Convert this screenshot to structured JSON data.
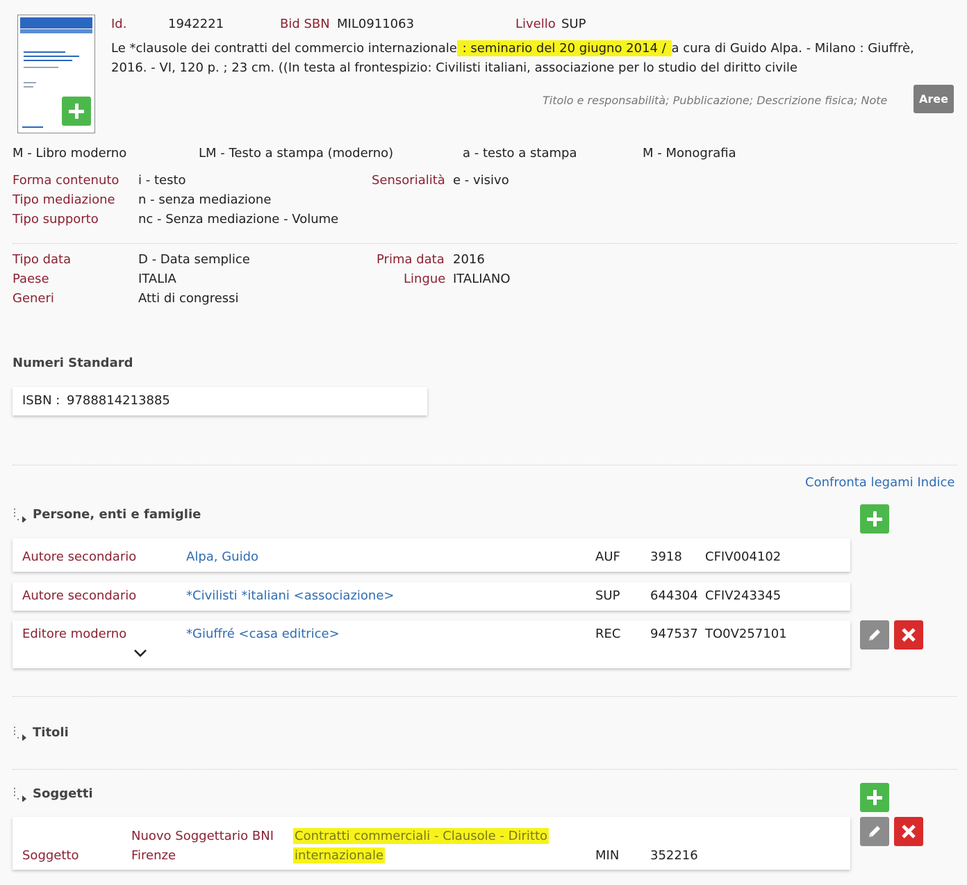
{
  "record": {
    "id_label": "Id.",
    "id_value": "1942221",
    "bid_label": "Bid SBN",
    "bid_value": "MIL0911063",
    "livello_label": "Livello",
    "livello_value": "SUP",
    "desc_part1": "Le *clausole dei contratti del commercio internazionale",
    "desc_highlight": " : seminario del 20 giugno 2014 / ",
    "desc_part2": "a cura di Guido Alpa. - Milano : Giuffrè,",
    "desc_line2": "2016. - VI, 120 p. ; 23 cm. ((In testa al frontespizio: Civilisti italiani, associazione per lo studio del diritto civile",
    "areas_note": "Titolo e responsabilità; Pubblicazione; Descrizione fisica; Note",
    "areas_button": "Aree"
  },
  "types": {
    "natura": "M - Libro moderno",
    "tipo_materiale": "LM - Testo a stampa (moderno)",
    "tipo_record": "a - testo a stampa",
    "livello_bib": "M - Monografia"
  },
  "content": {
    "forma_label": "Forma contenuto",
    "forma_value": "i - testo",
    "sens_label": "Sensorialità",
    "sens_value": "e - visivo",
    "mediazione_label": "Tipo mediazione",
    "mediazione_value": "n - senza mediazione",
    "supporto_label": "Tipo supporto",
    "supporto_value": "nc - Senza mediazione - Volume"
  },
  "dates": {
    "tipo_data_label": "Tipo data",
    "tipo_data_value": "D - Data semplice",
    "prima_data_label": "Prima data",
    "prima_data_value": "2016",
    "paese_label": "Paese",
    "paese_value": "ITALIA",
    "lingue_label": "Lingue",
    "lingue_value": "ITALIANO",
    "generi_label": "Generi",
    "generi_value": "Atti di congressi"
  },
  "standard_numbers": {
    "title": "Numeri Standard",
    "isbn_label": "ISBN :",
    "isbn_value": "9788814213885"
  },
  "confronta_link": "Confronta legami Indice",
  "persons": {
    "title": "Persone, enti e famiglie",
    "rows": [
      {
        "role": "Autore secondario",
        "name": "Alpa, Guido",
        "level": "AUF",
        "num": "3918",
        "code": "CFIV004102"
      },
      {
        "role": "Autore secondario",
        "name": "*Civilisti *italiani <associazione>",
        "level": "SUP",
        "num": "644304",
        "code": "CFIV243345"
      },
      {
        "role": "Editore moderno",
        "name": "*Giuffré <casa editrice>",
        "level": "REC",
        "num": "947537",
        "code": "TO0V257101"
      }
    ]
  },
  "titoli": {
    "title": "Titoli"
  },
  "soggetti": {
    "title": "Soggetti",
    "row": {
      "role": "Soggetto",
      "source_line1": "Nuovo Soggettario BNI",
      "source_line2": "Firenze",
      "term_line1": "Contratti commerciali - Clausole - Diritto",
      "term_line2": "internazionale",
      "level": "MIN",
      "num": "352216"
    }
  },
  "icons": {
    "add": "plus-icon",
    "edit": "pencil-icon",
    "delete": "close-icon",
    "expand": "chevron-down-icon",
    "section": "tree-arrow-icon"
  },
  "colors": {
    "label": "#8b2232",
    "link": "#2f6db5",
    "add": "#4cb84c",
    "delete": "#d92b2b",
    "edit": "#8c8c8c",
    "highlight": "#f7f31a"
  }
}
